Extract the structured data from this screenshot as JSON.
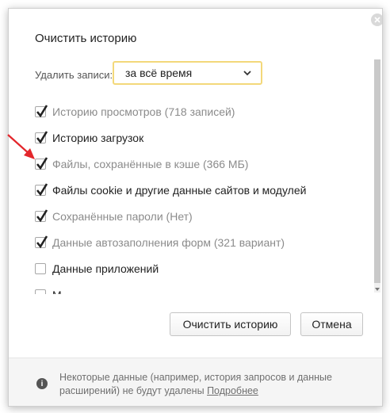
{
  "dialog": {
    "title": "Очистить историю",
    "delete_label": "Удалить записи:",
    "period_select": {
      "value": "за всё время"
    },
    "items": [
      {
        "label": "Историю просмотров",
        "detail": " (718 записей)",
        "checked": true
      },
      {
        "label": "Историю загрузок",
        "detail": "",
        "checked": true
      },
      {
        "label": "Файлы, сохранённые в кэше",
        "detail": " (366 МБ)",
        "checked": true
      },
      {
        "label": "Файлы cookie и другие данные сайтов и модулей",
        "detail": "",
        "checked": true
      },
      {
        "label": "Сохранённые пароли",
        "detail": " (Нет)",
        "checked": true
      },
      {
        "label": "Данные автозаполнения форм",
        "detail": " (321 вариант)",
        "checked": true
      },
      {
        "label": "Данные приложений",
        "detail": "",
        "checked": false
      },
      {
        "label": "М",
        "detail": "",
        "checked": false
      }
    ],
    "buttons": {
      "clear": "Очистить историю",
      "cancel": "Отмена"
    },
    "footer": {
      "text": "Некоторые данные (например, история запросов и данные расширений) не будут удалены",
      "link": "Подробнее"
    },
    "colors": {
      "select_border": "#f3d87a",
      "check": "#222222",
      "annotation_arrow": "#e3262b"
    },
    "icons": [
      "close-icon",
      "chevron-down-icon",
      "check-icon",
      "info-icon",
      "red-arrow-annotation"
    ]
  }
}
